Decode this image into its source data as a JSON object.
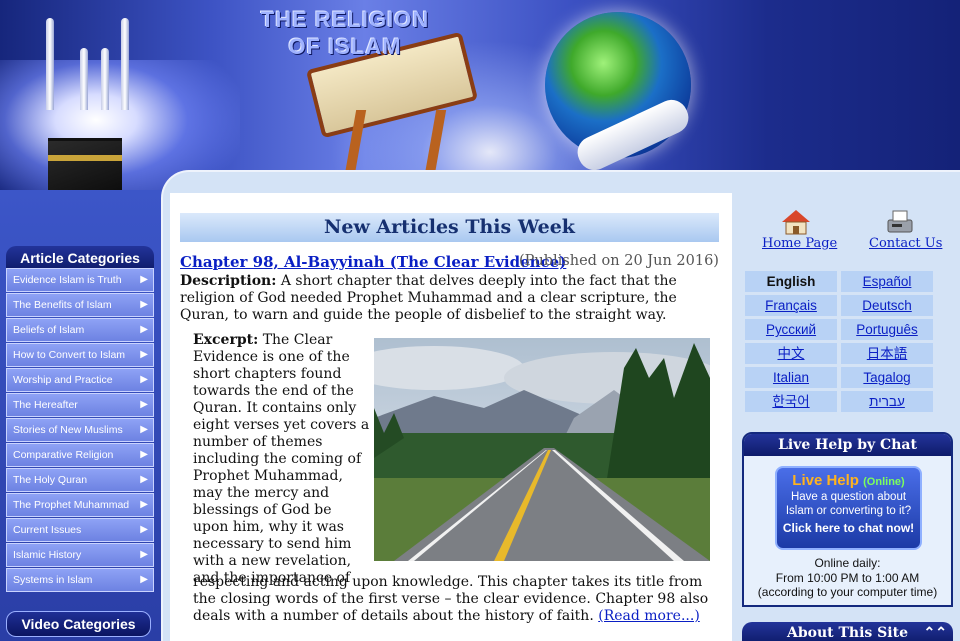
{
  "header": {
    "title_line1": "THE RELIGION",
    "title_line2": "OF ISLAM"
  },
  "sidebar": {
    "categories_title": "Article Categories",
    "categories": [
      "Evidence Islam is Truth",
      "The Benefits of Islam",
      "Beliefs of Islam",
      "How to Convert to Islam",
      "Worship and Practice",
      "The Hereafter",
      "Stories of New Muslims",
      "Comparative Religion",
      "The Holy Quran",
      "The Prophet Muhammad",
      "Current Issues",
      "Islamic History",
      "Systems in Islam"
    ],
    "arrow_glyph": "▶",
    "video_title": "Video Categories"
  },
  "main": {
    "section_title": "New Articles This Week",
    "article_title": "Chapter 98, Al-Bayyinah (The Clear Evidence)",
    "published": "(Published on 20 Jun 2016)",
    "description_label": "Description:",
    "description": " A short chapter that delves deeply into the fact that the religion of God needed Prophet Muhammad and a clear scripture, the Quran, to warn and guide the people of disbelief to the straight way.",
    "excerpt_label": "Excerpt:",
    "excerpt_col": " The Clear Evidence is one of the short chapters found towards the end of the Quran.  It contains only eight verses yet covers a number of themes including the coming of Prophet Muhammad, may the mercy and blessings of God be upon him, why it was necessary to send him with a new revelation, and the importance of",
    "excerpt_full": "respecting and acting upon knowledge.  This chapter takes its title from the closing words of the first verse – the clear evidence.  Chapter 98 also deals with a number of details about the history of faith. ",
    "read_more": "(Read more...)"
  },
  "right": {
    "home": "Home Page",
    "contact": "Contact Us",
    "languages": [
      "English",
      "Español",
      "Français",
      "Deutsch",
      "Русский",
      "Português",
      "中文",
      "日本語",
      "Italian",
      "Tagalog",
      "한국어",
      "עברית"
    ],
    "chat_title": "Live Help by Chat",
    "chat_btn_title": "Live Help",
    "chat_btn_status": "(Online)",
    "chat_btn_question": "Have a question about Islam or converting to it?",
    "chat_btn_cta": "Click here to chat now!",
    "online_label": "Online daily:",
    "online_hours": "From 10:00 PM to 1:00 AM",
    "online_note": "(according to your computer time)",
    "about_title": "About This Site",
    "about_glyph": "⌃⌃"
  },
  "colors": {
    "link": "#0a1fc4",
    "header_dark": "#0e1b6a",
    "lang_cell": "#b8d2f5",
    "chat_orange": "#ffb31e"
  }
}
